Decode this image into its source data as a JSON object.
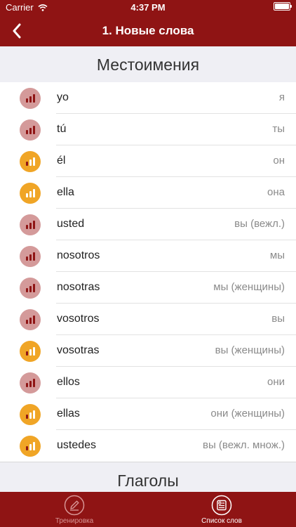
{
  "status_bar": {
    "carrier": "Carrier",
    "time": "4:37 PM",
    "battery_level": 1.0
  },
  "nav": {
    "title": "1. Новые слова"
  },
  "sections": [
    {
      "title": "Местоимения"
    },
    {
      "title": "Глаголы"
    }
  ],
  "words": [
    {
      "word": "yo",
      "translation": "я",
      "level": "low"
    },
    {
      "word": "tú",
      "translation": "ты",
      "level": "low"
    },
    {
      "word": "él",
      "translation": "он",
      "level": "medium"
    },
    {
      "word": "ella",
      "translation": "она",
      "level": "high"
    },
    {
      "word": "usted",
      "translation": "вы (вежл.)",
      "level": "low"
    },
    {
      "word": "nosotros",
      "translation": "мы",
      "level": "low"
    },
    {
      "word": "nosotras",
      "translation": "мы (женщины)",
      "level": "low"
    },
    {
      "word": "vosotros",
      "translation": "вы",
      "level": "low"
    },
    {
      "word": "vosotras",
      "translation": "вы (женщины)",
      "level": "medium"
    },
    {
      "word": "ellos",
      "translation": "они",
      "level": "low"
    },
    {
      "word": "ellas",
      "translation": "они (женщины)",
      "level": "medium"
    },
    {
      "word": "ustedes",
      "translation": "вы (вежл. множ.)",
      "level": "medium"
    }
  ],
  "tabs": [
    {
      "label": "Тренировка",
      "active": false,
      "icon": "pencil-icon"
    },
    {
      "label": "Список слов",
      "active": true,
      "icon": "word-list-icon"
    }
  ],
  "colors": {
    "bar_background": "#8f1414",
    "badge_low": "#d49a9a",
    "badge_orange": "#f0a526",
    "bar_dark": "#8f1414",
    "bar_light": "#ffffff",
    "tab_active": "#ffffff",
    "tab_inactive": "#d79494"
  }
}
